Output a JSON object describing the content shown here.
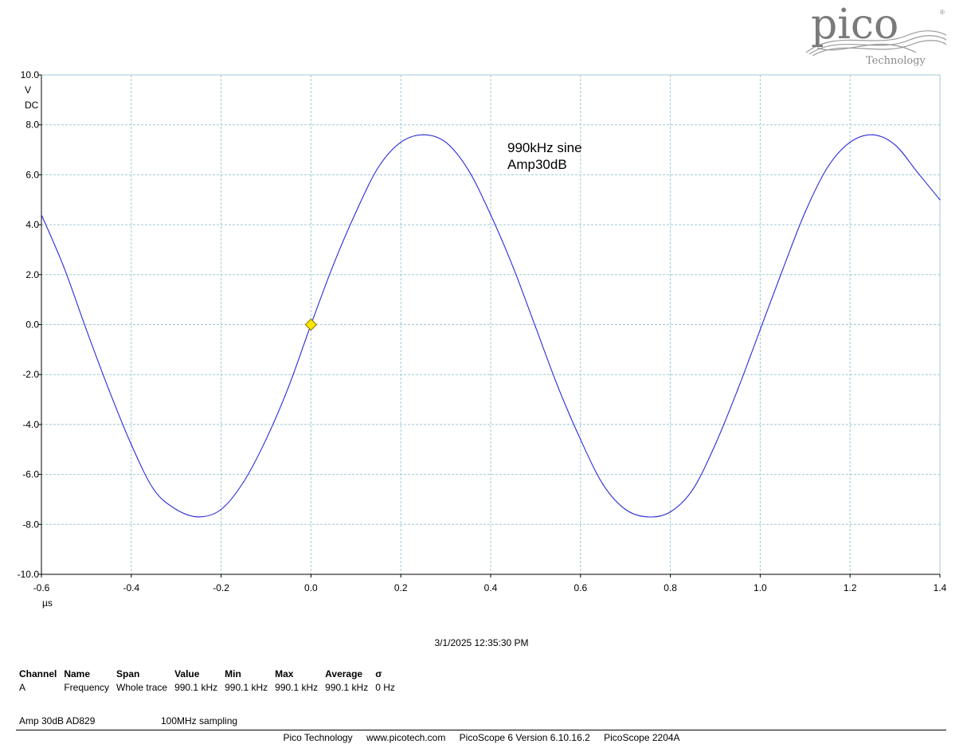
{
  "logo": {
    "word": "pico",
    "sub": "Technology",
    "reg": "®"
  },
  "annotation": [
    "990kHz sine",
    "Amp30dB"
  ],
  "timestamp": "3/1/2025 12:35:30 PM",
  "measurements": {
    "headers": [
      "Channel",
      "Name",
      "Span",
      "Value",
      "Min",
      "Max",
      "Average",
      "σ"
    ],
    "rows": [
      [
        "A",
        "Frequency",
        "Whole trace",
        "990.1 kHz",
        "990.1 kHz",
        "990.1 kHz",
        "990.1 kHz",
        "0 Hz"
      ]
    ]
  },
  "notes": {
    "left": "Amp 30dB AD829",
    "right": "100MHz sampling"
  },
  "footer": [
    "Pico Technology",
    "www.picotech.com",
    "PicoScope 6 Version 6.10.16.2",
    "PicoScope 2204A"
  ],
  "colors": {
    "trace": "#2b2bd9",
    "grid": "#9fc8d6",
    "marker": "#ffe600"
  },
  "chart_data": {
    "type": "line",
    "xlabel": "µs",
    "ylabel": "V",
    "ylabel2": "DC",
    "xlim": [
      -0.6,
      1.4
    ],
    "ylim": [
      -10.0,
      10.0
    ],
    "x_ticks": [
      -0.6,
      -0.4,
      -0.2,
      0.0,
      0.2,
      0.4,
      0.6,
      0.8,
      1.0,
      1.2,
      1.4
    ],
    "x_tick_labels": [
      "-0.6",
      "-0.4",
      "-0.2",
      "0.0",
      "0.2",
      "0.4",
      "0.6",
      "0.8",
      "1.0",
      "1.2",
      "1.4"
    ],
    "y_ticks": [
      10.0,
      8.0,
      6.0,
      4.0,
      2.0,
      0.0,
      -2.0,
      -4.0,
      -6.0,
      -8.0,
      -10.0
    ],
    "y_tick_labels": [
      "10.0",
      "8.0",
      "6.0",
      "4.0",
      "2.0",
      "0.0",
      "-2.0",
      "-4.0",
      "-6.0",
      "-8.0",
      "-10.0"
    ],
    "grid": true,
    "trigger_marker": {
      "x": 0.0,
      "y": 0.0
    },
    "series": [
      {
        "x": [
          -0.6,
          -0.55,
          -0.5,
          -0.45,
          -0.4,
          -0.35,
          -0.3,
          -0.25,
          -0.2,
          -0.15,
          -0.1,
          -0.05,
          0.0,
          0.05,
          0.1,
          0.15,
          0.2,
          0.25,
          0.3,
          0.35,
          0.4,
          0.45,
          0.5,
          0.55,
          0.6,
          0.65,
          0.7,
          0.75,
          0.8,
          0.85,
          0.9,
          0.95,
          1.0,
          1.05,
          1.1,
          1.15,
          1.2,
          1.25,
          1.3,
          1.35,
          1.4
        ],
        "values": [
          4.4,
          2.3,
          -0.2,
          -2.6,
          -4.8,
          -6.6,
          -7.4,
          -7.7,
          -7.4,
          -6.3,
          -4.6,
          -2.5,
          0.0,
          2.4,
          4.5,
          6.3,
          7.3,
          7.6,
          7.3,
          6.2,
          4.4,
          2.3,
          -0.1,
          -2.5,
          -4.6,
          -6.4,
          -7.4,
          -7.7,
          -7.5,
          -6.6,
          -4.8,
          -2.6,
          -0.2,
          2.2,
          4.5,
          6.3,
          7.3,
          7.6,
          7.2,
          6.1,
          5.0
        ]
      }
    ]
  }
}
